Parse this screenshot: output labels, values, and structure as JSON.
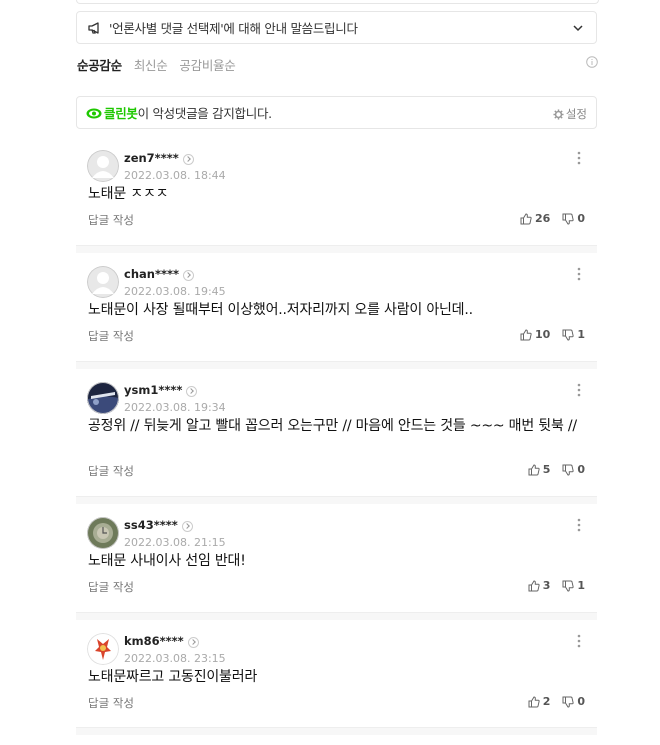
{
  "notice": {
    "text": "'언론사별 댓글 선택제'에 대해 안내 말씀드립니다"
  },
  "sort_tabs": [
    {
      "label": "순공감순",
      "active": true
    },
    {
      "label": "최신순",
      "active": false
    },
    {
      "label": "공감비율순",
      "active": false
    }
  ],
  "cleanbot": {
    "brand": "클린봇",
    "message": "이 악성댓글을 감지합니다.",
    "settings_label": "설정"
  },
  "comments": [
    {
      "nick": "zen7****",
      "date": "2022.03.08. 18:44",
      "body": "노태문 ㅈㅈㅈ",
      "reply_label": "답글 작성",
      "likes": "26",
      "dislikes": "0",
      "avatar": "default"
    },
    {
      "nick": "chan****",
      "date": "2022.03.08. 19:45",
      "body": "노태문이 사장 될때부터 이상했어..저자리까지 오를 사람이 아닌데..",
      "reply_label": "답글 작성",
      "likes": "10",
      "dislikes": "1",
      "avatar": "default"
    },
    {
      "nick": "ysm1****",
      "date": "2022.03.08. 19:34",
      "body": "공정위 // 뒤늦게 알고 빨대 꼽으러 오는구만 // 마음에 안드는 것들 ~~~ 매번 뒷북 //",
      "reply_label": "답글 작성",
      "likes": "5",
      "dislikes": "0",
      "avatar": "photo-dark"
    },
    {
      "nick": "ss43****",
      "date": "2022.03.08. 21:15",
      "body": "노태문 사내이사 선임 반대!",
      "reply_label": "답글 작성",
      "likes": "3",
      "dislikes": "1",
      "avatar": "photo-green"
    },
    {
      "nick": "km86****",
      "date": "2022.03.08. 23:15",
      "body": "노태문짜르고 고동진이불러라",
      "reply_label": "답글 작성",
      "likes": "2",
      "dislikes": "0",
      "avatar": "photo-character"
    }
  ],
  "colors": {
    "brand_green": "#1ec800",
    "border": "#e6e6e6",
    "muted_text": "#aaaaaa"
  }
}
